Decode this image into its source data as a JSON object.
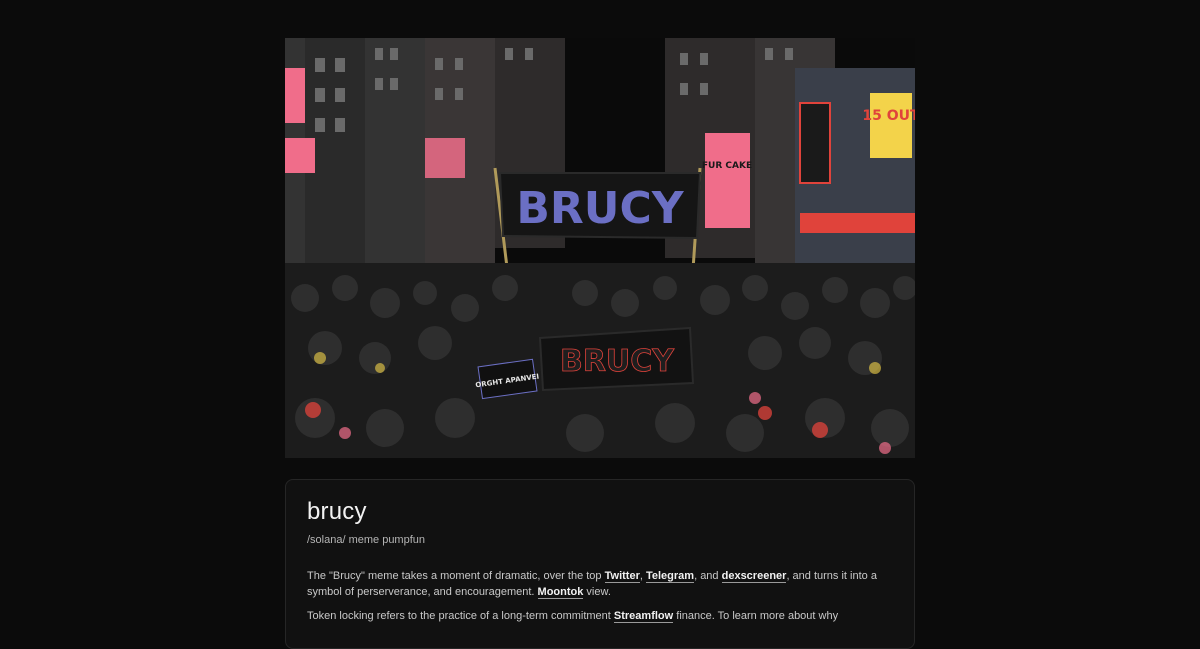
{
  "hero": {
    "banner_main": "BRUCY",
    "banner_lower": "BRUCY",
    "sign_small": "ORGHT APANVEI",
    "sign_shop": "15 OUT",
    "sign_pink": "FUR CAKE",
    "colors": {
      "sky": "#0a0a0a",
      "building_dark": "#262626",
      "building_mid": "#3b3b3b",
      "banner_text": "#6b6fc4",
      "crowd": "#1c1c1c",
      "pink": "#f06d8a",
      "yellow": "#f3d34a",
      "red": "#e0433b"
    }
  },
  "card": {
    "title": "brucy",
    "subtitle": "/solana/ meme pumpfun",
    "para1": {
      "t1": "The \"Brucy\" meme takes a moment of dramatic, over the top ",
      "link_twitter": "Twitter",
      "t2": ", ",
      "link_telegram": "Telegram",
      "t3": ", and ",
      "link_dexscreener": "dexscreener",
      "t4": ", and turns it into a symbol of perserverance, and encouragement. ",
      "link_moontok": "Moontok",
      "t5": " view."
    },
    "para2": {
      "t1": "Token locking refers to the practice of a long-term commitment ",
      "link_streamflow": "Streamflow",
      "t2": " finance. To learn more about why"
    }
  }
}
